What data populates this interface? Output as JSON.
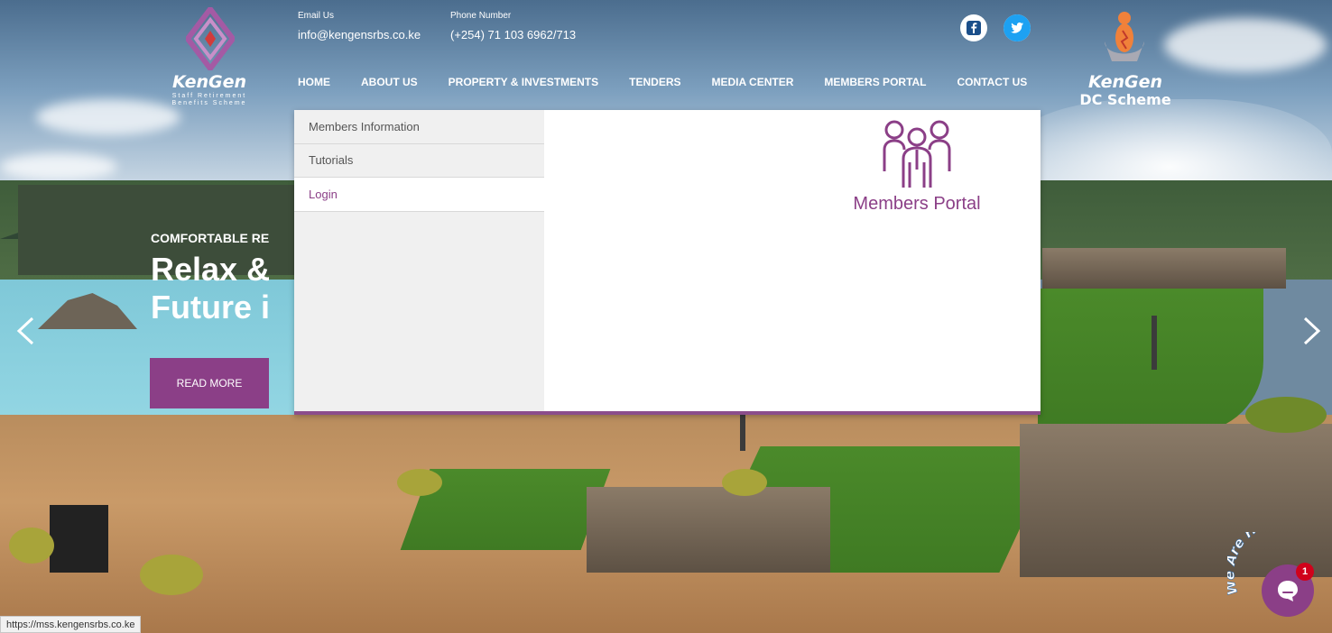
{
  "header": {
    "logo_left": {
      "name": "KenGen",
      "subtitle_line1": "Staff Retirement",
      "subtitle_line2": "Benefits Scheme"
    },
    "email_label": "Email Us",
    "email_value": "info@kengensrbs.co.ke",
    "phone_label": "Phone Number",
    "phone_value": "(+254) 71 103 6962/713",
    "logo_right": {
      "name": "KenGen",
      "subtitle": "DC Scheme"
    }
  },
  "social": [
    {
      "icon": "facebook-icon"
    },
    {
      "icon": "twitter-icon"
    }
  ],
  "nav": {
    "items": [
      "HOME",
      "ABOUT US",
      "PROPERTY & INVESTMENTS",
      "TENDERS",
      "MEDIA CENTER",
      "MEMBERS PORTAL",
      "CONTACT US"
    ]
  },
  "dropdown": {
    "items": [
      "Members Information",
      "Tutorials",
      "Login"
    ],
    "active": "Login",
    "panel_title": "Members Portal",
    "panel_icon": "members-group-icon"
  },
  "hero": {
    "kicker": "COMFORTABLE RE",
    "title_line1": "Relax &",
    "title_line2": "Future i",
    "button": "READ MORE"
  },
  "chat": {
    "badge_text": "We Are Here!",
    "count": "1"
  },
  "status_bar": {
    "url": "https://mss.kengensrbs.co.ke"
  },
  "colors": {
    "brand_purple": "#8b3f87",
    "menu_bg": "#f0f0f0"
  }
}
